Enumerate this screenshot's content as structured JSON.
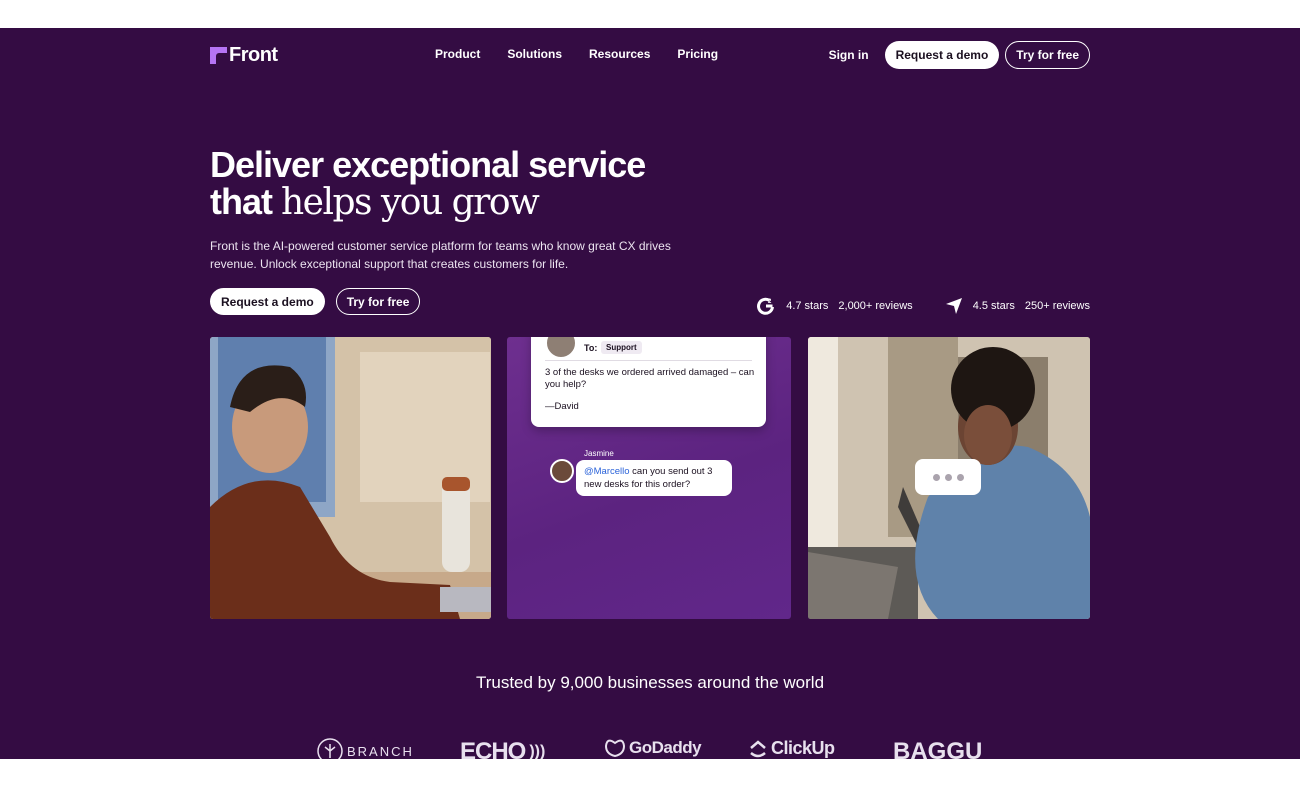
{
  "nav": {
    "logo_text": "Front",
    "links": [
      "Product",
      "Solutions",
      "Resources",
      "Pricing"
    ],
    "sign_in": "Sign in",
    "request_demo": "Request a demo",
    "try_free": "Try for free"
  },
  "hero": {
    "headline_line1": "Deliver exceptional service",
    "headline_line2_sans": "that ",
    "headline_line2_serif": "helps you grow",
    "subtext": "Front is the AI-powered customer service platform for teams who know great CX drives revenue. Unlock exceptional support that creates customers for life.",
    "request_demo": "Request a demo",
    "try_free": "Try for free"
  },
  "ratings": [
    {
      "icon": "g2-icon",
      "stars": "4.7 stars",
      "reviews": "2,000+ reviews"
    },
    {
      "icon": "capterra-icon",
      "stars": "4.5 stars",
      "reviews": "250+ reviews"
    }
  ],
  "email_card": {
    "to_label": "To:",
    "to_chip": "Support",
    "body": "3 of the desks we ordered arrived damaged – can you help?",
    "signature": "—David"
  },
  "chat": {
    "author": "Jasmine",
    "mention": "@Marcello",
    "message": " can you send out 3 new desks for this order?"
  },
  "trusted": {
    "title": "Trusted by 9,000 businesses around the world",
    "logos": [
      "BRANCH",
      "ECHO",
      "GoDaddy",
      "ClickUp",
      "BAGGU"
    ]
  },
  "colors": {
    "background": "#340c43",
    "accent": "#b574f4",
    "mention": "#2b63d9"
  }
}
